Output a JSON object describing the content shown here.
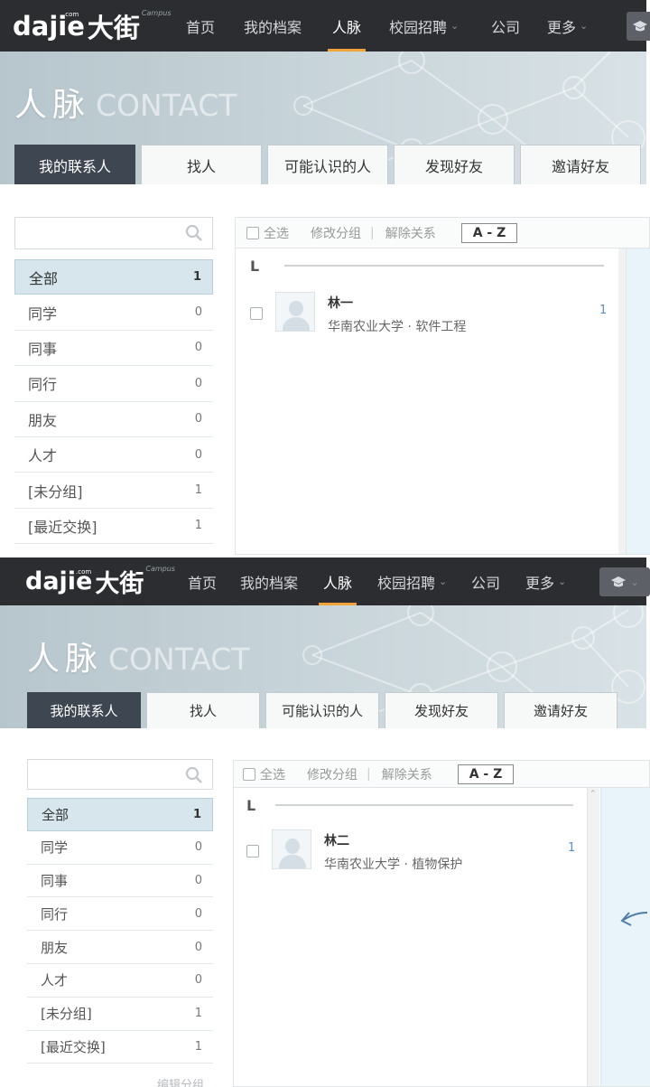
{
  "shots": [
    {
      "logo": {
        "text": "dajie",
        "dotcom": ".com",
        "cn": "大街",
        "campus": "Campus"
      },
      "nav": [
        {
          "label": "首页",
          "chevron": false
        },
        {
          "label": "我的档案",
          "chevron": false
        },
        {
          "label": "人脉",
          "chevron": false,
          "active": true
        },
        {
          "label": "校园招聘",
          "chevron": true
        },
        {
          "label": "公司",
          "chevron": false
        },
        {
          "label": "更多",
          "chevron": true
        }
      ],
      "banner": {
        "title_cn": "人脉",
        "title_en": "CONTACT"
      },
      "tabs": [
        "我的联系人",
        "找人",
        "可能认识的人",
        "发现好友",
        "邀请好友"
      ],
      "groups": [
        {
          "label": "全部",
          "count": "1"
        },
        {
          "label": "同学",
          "count": "0"
        },
        {
          "label": "同事",
          "count": "0"
        },
        {
          "label": "同行",
          "count": "0"
        },
        {
          "label": "朋友",
          "count": "0"
        },
        {
          "label": "人才",
          "count": "0"
        },
        {
          "label": "[未分组]",
          "count": "1"
        },
        {
          "label": "[最近交换]",
          "count": "1"
        }
      ],
      "toolbar": {
        "select_all": "全选",
        "modify_group": "修改分组",
        "divider": "|",
        "remove_relation": "解除关系",
        "az": "A - Z"
      },
      "letter": "L",
      "contact": {
        "name": "林一",
        "detail": "华南农业大学 · 软件工程",
        "count": "1"
      }
    },
    {
      "logo": {
        "text": "dajie",
        "dotcom": ".com",
        "cn": "大街",
        "campus": "Campus"
      },
      "nav": [
        {
          "label": "首页",
          "chevron": false
        },
        {
          "label": "我的档案",
          "chevron": false
        },
        {
          "label": "人脉",
          "chevron": false,
          "active": true
        },
        {
          "label": "校园招聘",
          "chevron": true
        },
        {
          "label": "公司",
          "chevron": false
        },
        {
          "label": "更多",
          "chevron": true
        }
      ],
      "banner": {
        "title_cn": "人脉",
        "title_en": "CONTACT"
      },
      "tabs": [
        "我的联系人",
        "找人",
        "可能认识的人",
        "发现好友",
        "邀请好友"
      ],
      "groups": [
        {
          "label": "全部",
          "count": "1"
        },
        {
          "label": "同学",
          "count": "0"
        },
        {
          "label": "同事",
          "count": "0"
        },
        {
          "label": "同行",
          "count": "0"
        },
        {
          "label": "朋友",
          "count": "0"
        },
        {
          "label": "人才",
          "count": "0"
        },
        {
          "label": "[未分组]",
          "count": "1"
        },
        {
          "label": "[最近交换]",
          "count": "1"
        }
      ],
      "toolbar": {
        "select_all": "全选",
        "modify_group": "修改分组",
        "divider": "|",
        "remove_relation": "解除关系",
        "az": "A - Z"
      },
      "letter": "L",
      "contact": {
        "name": "林二",
        "detail": "华南农业大学 · 植物保护",
        "count": "1"
      },
      "edit_group": "编辑分组"
    }
  ],
  "colors": {
    "nav_bg": "#2b2d30",
    "active_underline": "#f0a33a",
    "tab_active": "#3d4651",
    "link": "#5b8fc4"
  },
  "icons": [
    "search-icon",
    "graduation-cap-icon",
    "chevron-down-icon",
    "avatar-placeholder-icon"
  ]
}
